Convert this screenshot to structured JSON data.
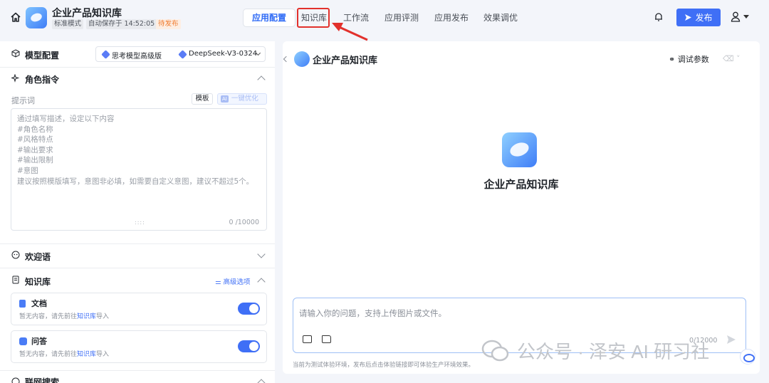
{
  "header": {
    "app_title": "企业产品知识库",
    "mode_tag": "标准模式",
    "autosave": "自动保存于 14:52:05",
    "status_tag": "待发布",
    "tabs": [
      {
        "label": "应用配置",
        "active": true
      },
      {
        "label": "知识库",
        "active": false
      },
      {
        "label": "工作流",
        "active": false
      },
      {
        "label": "应用评测",
        "active": false
      },
      {
        "label": "应用发布",
        "active": false
      },
      {
        "label": "效果调优",
        "active": false
      }
    ],
    "publish_label": "发布",
    "accent_color": "#3f6ff6",
    "highlight_color": "#e2312c"
  },
  "left": {
    "model_config": {
      "title": "模型配置",
      "model_a": "思考模型高级版",
      "model_b": "DeepSeek-V3-0324"
    },
    "role": {
      "title": "角色指令",
      "prompt_label": "提示词",
      "template_btn": "模板",
      "optimize_ai": "AI",
      "optimize_btn": "一键优化",
      "prompt_placeholder_lines": [
        "通过填写描述，设定以下内容",
        "#角色名称",
        "#风格特点",
        "#输出要求",
        "#输出限制",
        "#意图",
        "建议按照模版填写，意图非必填，如需要自定义意图，建议不超过5个。"
      ],
      "resize_glyph": "::::",
      "counter": "0 /10000"
    },
    "welcome": {
      "title": "欢迎语"
    },
    "knowledge": {
      "title": "知识库",
      "advanced": "高级选项",
      "cards": [
        {
          "name": "文档",
          "desc_prefix": "暂无内容，请先前往",
          "desc_link": "知识库",
          "desc_suffix": "导入",
          "enabled": true
        },
        {
          "name": "问答",
          "desc_prefix": "暂无内容，请先前往",
          "desc_link": "知识库",
          "desc_suffix": "导入",
          "enabled": true
        }
      ]
    },
    "web_search": {
      "title": "联网搜索"
    }
  },
  "right": {
    "title": "企业产品知识库",
    "debug_params": "调试参数",
    "center_title": "企业产品知识库",
    "chat_placeholder": "请输入你的问题，支持上传图片或文件。",
    "chat_counter": "0/12000",
    "footer_note": "当前为测试体验环境，发布后点击体验链接即可体验生产环境效果。"
  },
  "overlay": {
    "wechat_watermark": "公众号 · 泽安 AI 研习社"
  }
}
